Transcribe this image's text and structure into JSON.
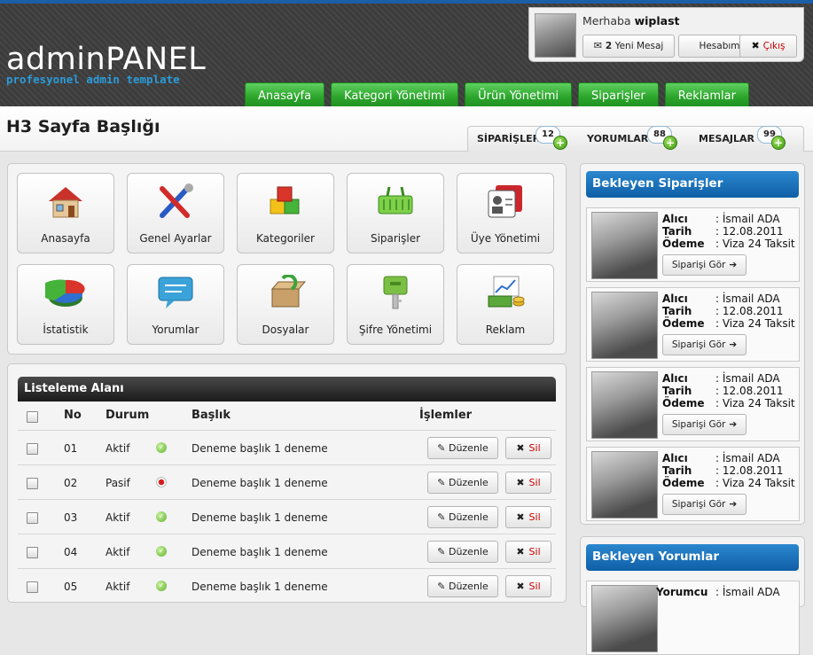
{
  "header": {
    "logo_title": "adminPANEL",
    "logo_subtitle": "profesyonel admin template",
    "greeting_prefix": "Merhaba",
    "username": "wiplast",
    "messages_count": "2",
    "messages_label": "Yeni Mesaj",
    "account_label": "Hesabım",
    "logout_label": "Çıkış"
  },
  "nav": [
    {
      "label": "Anasayfa"
    },
    {
      "label": "Kategori Yönetimi"
    },
    {
      "label": "Ürün Yönetimi"
    },
    {
      "label": "Siparişler"
    },
    {
      "label": "Reklamlar"
    }
  ],
  "page_title": "H3 Sayfa Başlığı",
  "tabs": [
    {
      "label": "SİPARİŞLER",
      "count": "12"
    },
    {
      "label": "YORUMLAR",
      "count": "88"
    },
    {
      "label": "MESAJLAR",
      "count": "99"
    }
  ],
  "tiles": [
    {
      "label": "Anasayfa",
      "icon": "home-icon"
    },
    {
      "label": "Genel Ayarlar",
      "icon": "tools-icon"
    },
    {
      "label": "Kategoriler",
      "icon": "cubes-icon"
    },
    {
      "label": "Siparişler",
      "icon": "basket-icon"
    },
    {
      "label": "Üye Yönetimi",
      "icon": "id-card-icon"
    },
    {
      "label": "İstatistik",
      "icon": "pie-chart-icon"
    },
    {
      "label": "Yorumlar",
      "icon": "comment-icon"
    },
    {
      "label": "Dosyalar",
      "icon": "box-icon"
    },
    {
      "label": "Şifre Yönetimi",
      "icon": "key-icon"
    },
    {
      "label": "Reklam",
      "icon": "money-icon"
    }
  ],
  "list": {
    "title": "Listeleme Alanı",
    "columns": {
      "no": "No",
      "status": "Durum",
      "title": "Başlık",
      "actions": "İşlemler"
    },
    "edit_label": "Düzenle",
    "delete_label": "Sil",
    "rows": [
      {
        "no": "01",
        "status": "Aktif",
        "active": true,
        "title": "Deneme başlık 1 deneme"
      },
      {
        "no": "02",
        "status": "Pasif",
        "active": false,
        "title": "Deneme başlık 1 deneme"
      },
      {
        "no": "03",
        "status": "Aktif",
        "active": true,
        "title": "Deneme başlık 1 deneme"
      },
      {
        "no": "04",
        "status": "Aktif",
        "active": true,
        "title": "Deneme başlık 1 deneme"
      },
      {
        "no": "05",
        "status": "Aktif",
        "active": true,
        "title": "Deneme başlık 1 deneme"
      }
    ]
  },
  "orders": {
    "title": "Bekleyen Siparişler",
    "labels": {
      "buyer": "Alıcı",
      "date": "Tarih",
      "payment": "Ödeme"
    },
    "button_label": "Siparişi Gör",
    "items": [
      {
        "buyer": ": İsmail ADA",
        "date": ": 12.08.2011",
        "payment": ": Viza 24 Taksit"
      },
      {
        "buyer": ": İsmail ADA",
        "date": ": 12.08.2011",
        "payment": ": Viza 24 Taksit"
      },
      {
        "buyer": ": İsmail ADA",
        "date": ": 12.08.2011",
        "payment": ": Viza 24 Taksit"
      },
      {
        "buyer": ": İsmail ADA",
        "date": ": 12.08.2011",
        "payment": ": Viza 24 Taksit"
      }
    ]
  },
  "comments": {
    "title": "Bekleyen Yorumlar",
    "author_label": "Yorumcu",
    "author_value": ": İsmail ADA"
  },
  "colors": {
    "nav_green": "#2ba42b",
    "sidebar_blue": "#1f74bf",
    "delete_red": "#cc0000"
  }
}
